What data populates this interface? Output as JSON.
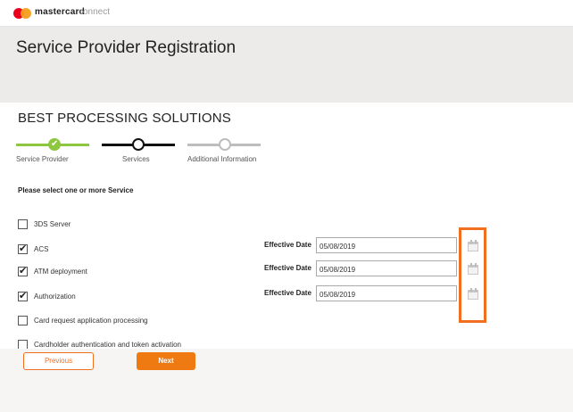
{
  "header": {
    "brand": "mastercard",
    "brand_sub": "connect"
  },
  "page": {
    "title": "Service Provider Registration",
    "company": "BEST PROCESSING SOLUTIONS"
  },
  "stepper": {
    "steps": [
      {
        "label": "Service Provider",
        "state": "complete",
        "color": "#8dc63f"
      },
      {
        "label": "Services",
        "state": "current",
        "color": "#111111"
      },
      {
        "label": "Additional Information",
        "state": "upcoming",
        "color": "#bdbdbd"
      }
    ]
  },
  "form": {
    "prompt": "Please select one or more Service",
    "effective_label": "Effective Date",
    "services": [
      {
        "label": "3DS Server",
        "checked": false
      },
      {
        "label": "ACS",
        "checked": true,
        "effective_date": "05/08/2019"
      },
      {
        "label": "ATM deployment",
        "checked": true,
        "effective_date": "05/08/2019"
      },
      {
        "label": "Authorization",
        "checked": true,
        "effective_date": "05/08/2019"
      },
      {
        "label": "Card request application processing",
        "checked": false
      },
      {
        "label": "Cardholder authentication and token activation",
        "checked": false
      }
    ],
    "check_glyph": "✔"
  },
  "buttons": {
    "previous": "Previous",
    "next": "Next"
  },
  "colors": {
    "accent": "#f26e21",
    "complete": "#8dc63f",
    "banner": "#ecebe9"
  },
  "icons": {
    "logo": "mastercard-logo",
    "calendar": "calendar-icon",
    "check": "checkmark-icon"
  }
}
